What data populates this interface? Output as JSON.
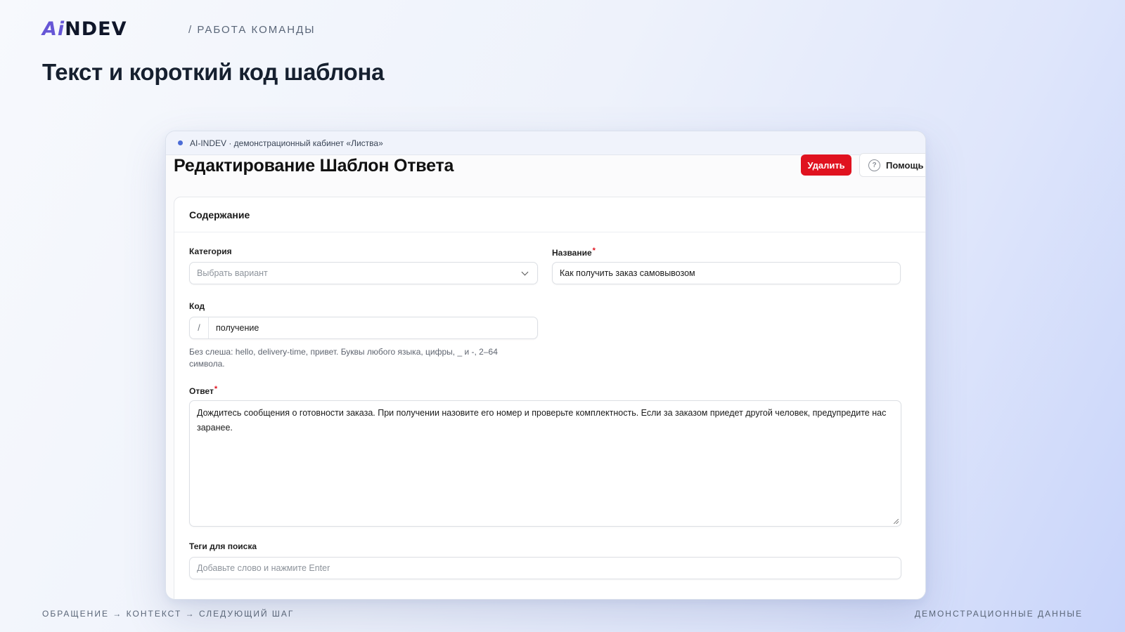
{
  "slide": {
    "logo_prefix": "Ai",
    "logo_suffix": "NDEV",
    "section": "/ РАБОТА КОМАНДЫ",
    "title": "Текст и короткий код шаблона",
    "footer_left": "ОБРАЩЕНИЕ → КОНТЕКСТ → СЛЕДУЮЩИЙ ШАГ",
    "footer_right": "ДЕМОНСТРАЦИОННЫЕ ДАННЫЕ"
  },
  "window": {
    "bar_text": "AI-INDEV · демонстрационный кабинет «Листва»",
    "page_title": "Редактирование Шаблон Ответа",
    "delete_label": "Удалить",
    "help_label": "Помощь",
    "help_icon": "question-circle-icon"
  },
  "form": {
    "section_title": "Содержание",
    "category": {
      "label": "Категория",
      "placeholder": "Выбрать вариант"
    },
    "name": {
      "label": "Название",
      "required_mark": "*",
      "value": "Как получить заказ самовывозом"
    },
    "code": {
      "label": "Код",
      "prefix": "/",
      "value": "получение",
      "hint": "Без слеша: hello, delivery-time, привет. Буквы любого языка, цифры, _ и -, 2–64 символа."
    },
    "answer": {
      "label": "Ответ",
      "required_mark": "*",
      "value": "Дождитесь сообщения о готовности заказа. При получении назовите его номер и проверьте комплектность. Если за заказом приедет другой человек, предупредите нас заранее."
    },
    "tags": {
      "label": "Теги для поиска",
      "placeholder": "Добавьте слово и нажмите Enter"
    }
  },
  "colors": {
    "accent": "#6656d6",
    "danger": "#e0121f",
    "status_dot": "#4b6cd6"
  }
}
